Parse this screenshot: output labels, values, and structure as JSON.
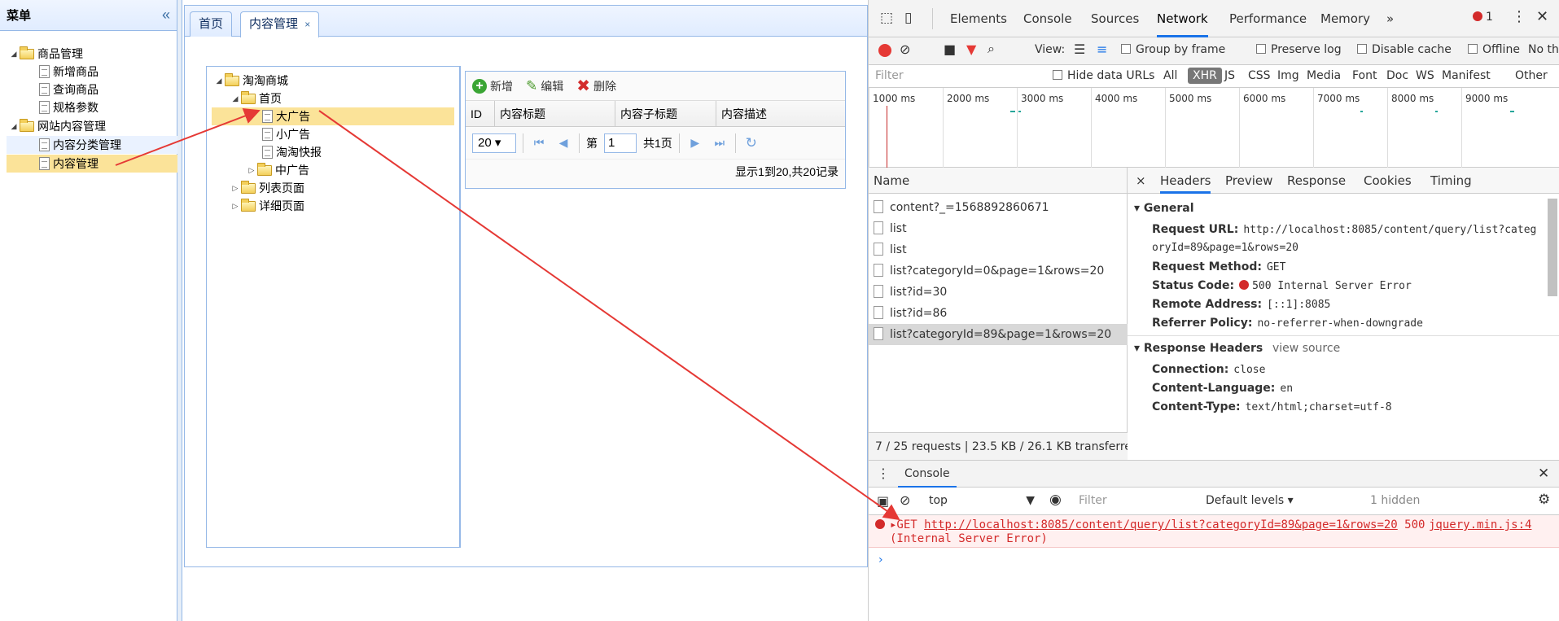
{
  "menu": {
    "title": "菜单",
    "collapse_glyph": "«",
    "groups": [
      {
        "label": "商品管理",
        "items": [
          "新增商品",
          "查询商品",
          "规格参数"
        ]
      },
      {
        "label": "网站内容管理",
        "items": [
          "内容分类管理",
          "内容管理"
        ]
      }
    ]
  },
  "tabs": [
    {
      "label": "首页"
    },
    {
      "label": "内容管理",
      "close": "×"
    }
  ],
  "category_tree": {
    "root": "淘淘商城",
    "home": "首页",
    "home_children": [
      "大广告",
      "小广告",
      "淘淘快报",
      "中广告"
    ],
    "others": [
      "列表页面",
      "详细页面"
    ]
  },
  "grid": {
    "toolbar": {
      "add": "新增",
      "edit": "编辑",
      "delete": "删除"
    },
    "columns": [
      "ID",
      "内容标题",
      "内容子标题",
      "内容描述"
    ],
    "pager": {
      "page_size": "20",
      "page_prefix": "第",
      "page_value": "1",
      "page_suffix": "共1页",
      "info": "显示1到20,共20记录"
    }
  },
  "devtools": {
    "tabs": [
      "Elements",
      "Console",
      "Sources",
      "Network",
      "Performance",
      "Memory",
      "»"
    ],
    "active_tab": "Network",
    "error_count": "1",
    "toolbar": {
      "view": "View:",
      "group_by_frame": "Group by frame",
      "preserve_log": "Preserve log",
      "disable_cache": "Disable cache",
      "offline": "Offline",
      "throttle": "No th"
    },
    "filter": {
      "placeholder": "Filter",
      "hide_data_urls": "Hide data URLs",
      "types": [
        "All",
        "XHR",
        "JS",
        "CSS",
        "Img",
        "Media",
        "Font",
        "Doc",
        "WS",
        "Manifest",
        "Other"
      ]
    },
    "timeline_ticks": [
      "1000 ms",
      "2000 ms",
      "3000 ms",
      "4000 ms",
      "5000 ms",
      "6000 ms",
      "7000 ms",
      "8000 ms",
      "9000 ms"
    ],
    "name_header": "Name",
    "requests": [
      "content?_=1568892860671",
      "list",
      "list",
      "list?categoryId=0&page=1&rows=20",
      "list?id=30",
      "list?id=86",
      "list?categoryId=89&page=1&rows=20"
    ],
    "status_bar": "7 / 25 requests  |  23.5 KB / 26.1 KB transferre",
    "detail_tabs": [
      "×",
      "Headers",
      "Preview",
      "Response",
      "Cookies",
      "Timing"
    ],
    "general": {
      "title": "▾ General",
      "request_url_label": "Request URL:",
      "request_url_1": "http://localhost:8085/content/query/list?categ",
      "request_url_2": "oryId=89&page=1&rows=20",
      "method_label": "Request Method:",
      "method": "GET",
      "status_label": "Status Code:",
      "status": "500 Internal Server Error",
      "remote_label": "Remote Address:",
      "remote": "[::1]:8085",
      "referrer_label": "Referrer Policy:",
      "referrer": "no-referrer-when-downgrade"
    },
    "response_headers": {
      "title": "▾ Response Headers",
      "view_source": "view source",
      "connection_label": "Connection:",
      "connection": "close",
      "lang_label": "Content-Language:",
      "lang": "en",
      "type_label": "Content-Type:",
      "type": "text/html;charset=utf-8"
    },
    "console": {
      "title": "Console",
      "context": "top",
      "filter_placeholder": "Filter",
      "levels": "Default levels ▾",
      "hidden": "1 hidden",
      "error_line1_prefix": "▸GET ",
      "error_url": "http://localhost:8085/content/query/list?categoryId=89&page=1&rows=20",
      "error_code": " 500",
      "error_source": "jquery.min.js:4",
      "error_line2": "(Internal Server Error)",
      "prompt": "›"
    }
  }
}
